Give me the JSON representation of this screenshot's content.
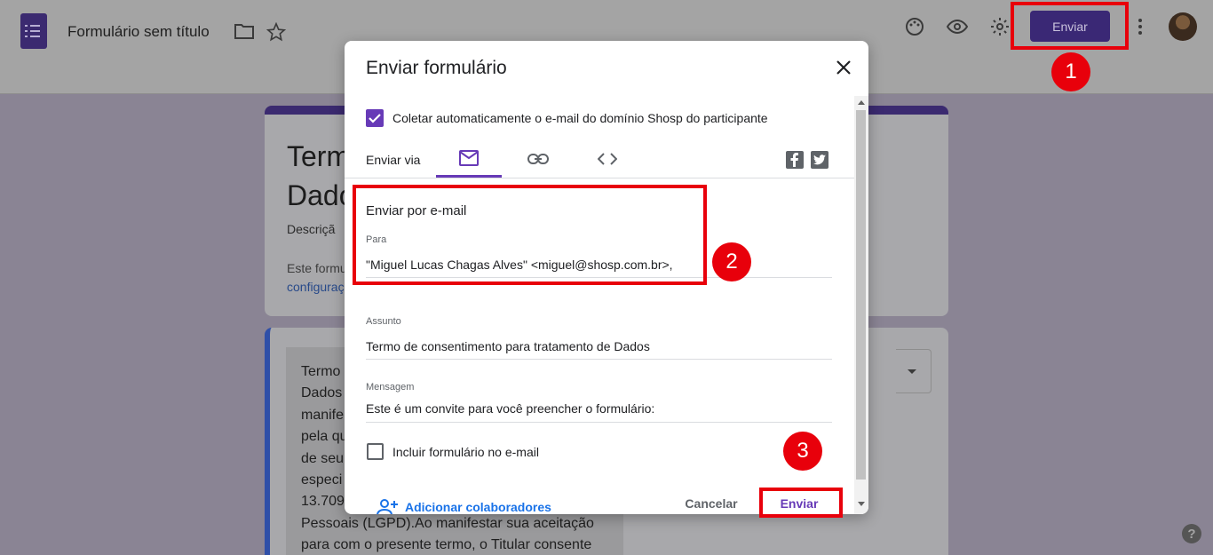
{
  "app": {
    "doc_title": "Formulário sem título",
    "send_label": "Enviar"
  },
  "background": {
    "form_title": "Termo de consentimento para tratamento de Dados",
    "form_title_line1": "Term",
    "form_title_line2": "Dado",
    "description_fragment": "Descriçã",
    "notice_fragment": "Este formu",
    "settings_link_fragment": "configuraç",
    "question_text_lines": [
      "Termo",
      "Dados",
      "manife",
      "pela qu",
      "de seu",
      "especi",
      "13.709",
      "Pessoais (LGPD).Ao manifestar sua aceitação",
      "para com o presente termo, o Titular consente"
    ],
    "help_glyph": "?"
  },
  "dialog": {
    "title": "Enviar formulário",
    "collect_email_label": "Coletar automaticamente o e-mail do domínio Shosp do participante",
    "collect_email_checked": true,
    "send_via_label": "Enviar via",
    "tabs": [
      {
        "icon": "email-icon",
        "active": true
      },
      {
        "icon": "link-icon",
        "active": false
      },
      {
        "icon": "embed-code-icon",
        "active": false
      }
    ],
    "social": [
      "facebook-icon",
      "twitter-icon"
    ],
    "email_section": {
      "heading": "Enviar por e-mail",
      "to_label": "Para",
      "to_value": "\"Miguel Lucas Chagas Alves\" <miguel@shosp.com.br>,",
      "subject_label": "Assunto",
      "subject_value": "Termo de consentimento para tratamento de Dados",
      "message_label": "Mensagem",
      "message_value": "Este é um convite para você preencher o formulário:",
      "include_form_label": "Incluir formulário no e-mail",
      "include_form_checked": false
    },
    "add_collaborators_label": "Adicionar colaboradores",
    "cancel_label": "Cancelar",
    "send_label": "Enviar"
  },
  "annotations": {
    "badge_1": "1",
    "badge_2": "2",
    "badge_3": "3",
    "color": "#e8000b"
  },
  "colors": {
    "accent": "#673ab7",
    "link": "#1a73e8"
  }
}
